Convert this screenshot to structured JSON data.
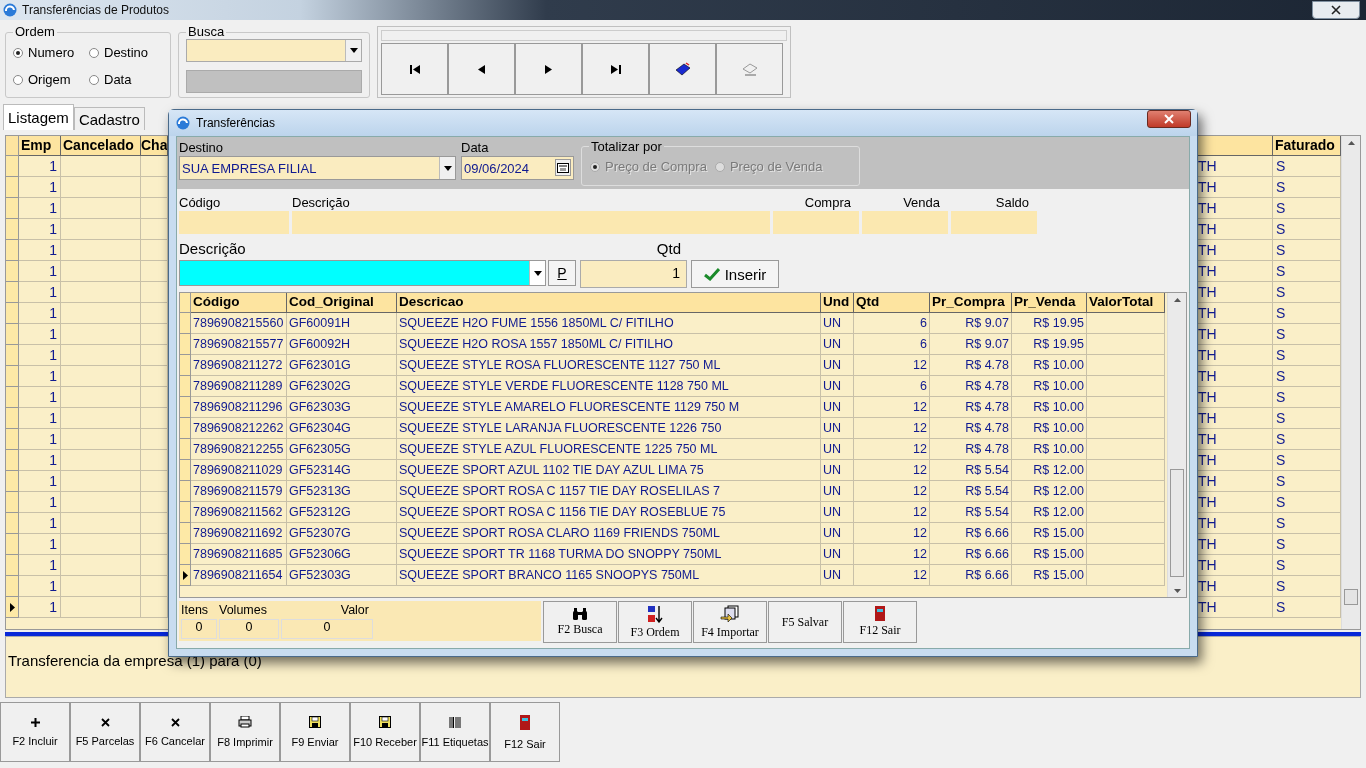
{
  "window": {
    "title": "Transferências de Produtos"
  },
  "ordem": {
    "label": "Ordem",
    "options": [
      {
        "label": "Numero",
        "selected": true
      },
      {
        "label": "Destino",
        "selected": false
      },
      {
        "label": "Origem",
        "selected": false
      },
      {
        "label": "Data",
        "selected": false
      }
    ]
  },
  "busca": {
    "label": "Busca"
  },
  "nav_buttons": [
    {
      "kind": "first"
    },
    {
      "kind": "prev"
    },
    {
      "kind": "next"
    },
    {
      "kind": "last"
    },
    {
      "kind": "book"
    },
    {
      "kind": "goto"
    }
  ],
  "tabs": [
    {
      "label": "Listagem",
      "selected": true
    },
    {
      "label": "Cadastro",
      "selected": false
    }
  ],
  "grid": {
    "columns_left": [
      "Emp",
      "Cancelado",
      "Cha"
    ],
    "columns_right": [
      "Faturado"
    ],
    "rows": [
      {
        "emp": "1",
        "column_right": "TH",
        "faturado": "S",
        "current": false
      },
      {
        "emp": "1",
        "column_right": "TH",
        "faturado": "S",
        "current": false
      },
      {
        "emp": "1",
        "column_right": "TH",
        "faturado": "S",
        "current": false
      },
      {
        "emp": "1",
        "column_right": "TH",
        "faturado": "S",
        "current": false
      },
      {
        "emp": "1",
        "column_right": "TH",
        "faturado": "S",
        "current": false
      },
      {
        "emp": "1",
        "column_right": "TH",
        "faturado": "S",
        "current": false
      },
      {
        "emp": "1",
        "column_right": "TH",
        "faturado": "S",
        "current": false
      },
      {
        "emp": "1",
        "column_right": "TH",
        "faturado": "S",
        "current": false
      },
      {
        "emp": "1",
        "column_right": "TH",
        "faturado": "S",
        "current": false
      },
      {
        "emp": "1",
        "column_right": "TH",
        "faturado": "S",
        "current": false
      },
      {
        "emp": "1",
        "column_right": "TH",
        "faturado": "S",
        "current": false
      },
      {
        "emp": "1",
        "column_right": "TH",
        "faturado": "S",
        "current": false
      },
      {
        "emp": "1",
        "column_right": "TH",
        "faturado": "S",
        "current": false
      },
      {
        "emp": "1",
        "column_right": "TH",
        "faturado": "S",
        "current": false
      },
      {
        "emp": "1",
        "column_right": "TH",
        "faturado": "S",
        "current": false
      },
      {
        "emp": "1",
        "column_right": "TH",
        "faturado": "S",
        "current": false
      },
      {
        "emp": "1",
        "column_right": "TH",
        "faturado": "S",
        "current": false
      },
      {
        "emp": "1",
        "column_right": "TH",
        "faturado": "S",
        "current": false
      },
      {
        "emp": "1",
        "column_right": "TH",
        "faturado": "S",
        "current": false
      },
      {
        "emp": "1",
        "column_right": "TH",
        "faturado": "S",
        "current": false
      },
      {
        "emp": "1",
        "column_right": "TH",
        "faturado": "S",
        "current": false
      },
      {
        "emp": "1",
        "column_right": "TH",
        "faturado": "S",
        "current": true
      }
    ]
  },
  "memo": "Transferencia da empresa (1) para (0)",
  "toolbar": [
    {
      "label": "F2 Incluir",
      "kind": "plus"
    },
    {
      "label": "F5 Parcelas",
      "kind": "cross"
    },
    {
      "label": "F6 Cancelar",
      "kind": "cross"
    },
    {
      "label": "F8 Imprimir",
      "kind": "printer"
    },
    {
      "label": "F9 Enviar",
      "kind": "floppy"
    },
    {
      "label": "F10 Receber",
      "kind": "floppy"
    },
    {
      "label": "F11 Etiquetas",
      "kind": "barcode"
    },
    {
      "label": "F12 Sair",
      "kind": "door"
    }
  ],
  "dialog": {
    "title": "Transferências",
    "destino": {
      "label": "Destino",
      "value": "SUA EMPRESA FILIAL"
    },
    "data": {
      "label": "Data",
      "value": "09/06/2024"
    },
    "totalizar": {
      "label": "Totalizar por",
      "disabled": true,
      "options": [
        {
          "label": "Preço de Compra",
          "selected": true
        },
        {
          "label": "Preço de Venda",
          "selected": false
        }
      ]
    },
    "product_fields": [
      "Código",
      "Descrição",
      "Compra",
      "Venda",
      "Saldo"
    ],
    "descricao_label": "Descrição",
    "p_button": "P",
    "qtd": {
      "label": "Qtd",
      "value": "1"
    },
    "insert_button": "Inserir",
    "columns": [
      "Código",
      "Cod_Original",
      "Descricao",
      "Und",
      "Qtd",
      "Pr_Compra",
      "Pr_Venda",
      "ValorTotal"
    ],
    "rows": [
      {
        "codigo": "7896908215560",
        "cod_original": "GF60091H",
        "descricao": "SQUEEZE H2O FUME 1556 1850ML C/ FITILHO",
        "und": "UN",
        "qtd": "6",
        "pr_compra": "R$ 9.07",
        "pr_venda": "R$ 19.95",
        "current": false
      },
      {
        "codigo": "7896908215577",
        "cod_original": "GF60092H",
        "descricao": "SQUEEZE H2O ROSA 1557 1850ML C/ FITILHO",
        "und": "UN",
        "qtd": "6",
        "pr_compra": "R$ 9.07",
        "pr_venda": "R$ 19.95",
        "current": false
      },
      {
        "codigo": "7896908211272",
        "cod_original": "GF62301G",
        "descricao": "SQUEEZE STYLE ROSA FLUORESCENTE 1127 750 ML",
        "und": "UN",
        "qtd": "12",
        "pr_compra": "R$ 4.78",
        "pr_venda": "R$ 10.00",
        "current": false
      },
      {
        "codigo": "7896908211289",
        "cod_original": "GF62302G",
        "descricao": "SQUEEZE STYLE VERDE FLUORESCENTE 1128 750 ML",
        "und": "UN",
        "qtd": "6",
        "pr_compra": "R$ 4.78",
        "pr_venda": "R$ 10.00",
        "current": false
      },
      {
        "codigo": "7896908211296",
        "cod_original": "GF62303G",
        "descricao": "SQUEEZE STYLE AMARELO FLUORESCENTE 1129 750 M",
        "und": "UN",
        "qtd": "12",
        "pr_compra": "R$ 4.78",
        "pr_venda": "R$ 10.00",
        "current": false
      },
      {
        "codigo": "7896908212262",
        "cod_original": "GF62304G",
        "descricao": "SQUEEZE STYLE LARANJA  FLUORESCENTE 1226 750",
        "und": "UN",
        "qtd": "12",
        "pr_compra": "R$ 4.78",
        "pr_venda": "R$ 10.00",
        "current": false
      },
      {
        "codigo": "7896908212255",
        "cod_original": "GF62305G",
        "descricao": "SQUEEZE STYLE AZUL FLUORESCENTE 1225 750 ML",
        "und": "UN",
        "qtd": "12",
        "pr_compra": "R$ 4.78",
        "pr_venda": "R$ 10.00",
        "current": false
      },
      {
        "codigo": "7896908211029",
        "cod_original": "GF52314G",
        "descricao": "SQUEEZE SPORT AZUL 1102 TIE DAY AZUL LIMA  75",
        "und": "UN",
        "qtd": "12",
        "pr_compra": "R$ 5.54",
        "pr_venda": "R$ 12.00",
        "current": false
      },
      {
        "codigo": "7896908211579",
        "cod_original": "GF52313G",
        "descricao": "SQUEEZE SPORT ROSA C 1157 TIE DAY ROSELILAS 7",
        "und": "UN",
        "qtd": "12",
        "pr_compra": "R$ 5.54",
        "pr_venda": "R$ 12.00",
        "current": false
      },
      {
        "codigo": "7896908211562",
        "cod_original": "GF52312G",
        "descricao": "SQUEEZE SPORT ROSA C 1156 TIE DAY ROSEBLUE 75",
        "und": "UN",
        "qtd": "12",
        "pr_compra": "R$ 5.54",
        "pr_venda": "R$ 12.00",
        "current": false
      },
      {
        "codigo": "7896908211692",
        "cod_original": "GF52307G",
        "descricao": "SQUEEZE SPORT ROSA CLARO 1169 FRIENDS 750ML",
        "und": "UN",
        "qtd": "12",
        "pr_compra": "R$ 6.66",
        "pr_venda": "R$ 15.00",
        "current": false
      },
      {
        "codigo": "7896908211685",
        "cod_original": "GF52306G",
        "descricao": "SQUEEZE SPORT TR 1168 TURMA DO SNOPPY 750ML",
        "und": "UN",
        "qtd": "12",
        "pr_compra": "R$ 6.66",
        "pr_venda": "R$ 15.00",
        "current": false
      },
      {
        "codigo": "7896908211654",
        "cod_original": "GF52303G",
        "descricao": "SQUEEZE SPORT BRANCO 1165 SNOOPYS 750ML",
        "und": "UN",
        "qtd": "12",
        "pr_compra": "R$ 6.66",
        "pr_venda": "R$ 15.00",
        "current": true
      }
    ],
    "totals": [
      {
        "label": "Itens",
        "value": "0"
      },
      {
        "label": "Volumes",
        "value": "0"
      },
      {
        "label": "Valor",
        "value": "0"
      }
    ],
    "buttons": [
      {
        "label": "F2 Busca",
        "kind": "binoculars"
      },
      {
        "label": "F3 Ordem",
        "kind": "sort"
      },
      {
        "label": "F4 Importar",
        "kind": "import"
      },
      {
        "label": "F5 Salvar",
        "kind": "none"
      },
      {
        "label": "F12 Sair",
        "kind": "door"
      }
    ]
  }
}
